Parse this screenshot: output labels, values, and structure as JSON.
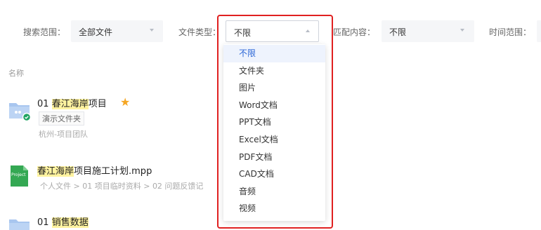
{
  "filters": {
    "search_scope": {
      "label": "搜索范围：",
      "value": "全部文件"
    },
    "file_type": {
      "label": "文件类型：",
      "value": "不限"
    },
    "match_content": {
      "label": "匹配内容：",
      "value": "不限"
    },
    "time_range": {
      "label": "时间范围："
    }
  },
  "list": {
    "column_name": "名称"
  },
  "files": [
    {
      "prefix": "01 ",
      "highlight": "春江海岸",
      "suffix": "项目",
      "tag": "演示文件夹",
      "meta": "杭州-项目团队"
    },
    {
      "prefix": "",
      "highlight": "春江海岸",
      "suffix": "项目施工计划.mpp",
      "icon_text": "Project",
      "path": [
        "个人文件",
        "01 项目临时资料",
        "02 问题反馈记"
      ]
    },
    {
      "prefix": "01 ",
      "highlight": "销售数据",
      "suffix": ""
    }
  ],
  "path_separator": ">",
  "dropdown": {
    "options": [
      "不限",
      "文件夹",
      "图片",
      "Word文档",
      "PPT文档",
      "Excel文档",
      "PDF文档",
      "CAD文档",
      "音频",
      "视频"
    ],
    "selected_index": 0
  },
  "colors": {
    "accent": "#2b66d6",
    "highlight": "#fff3a0",
    "annotation_box": "#e02020",
    "star": "#f5a623",
    "shared_badge": "#1fa463",
    "project_icon": "#34a853",
    "folder": "#a8c6ef"
  }
}
